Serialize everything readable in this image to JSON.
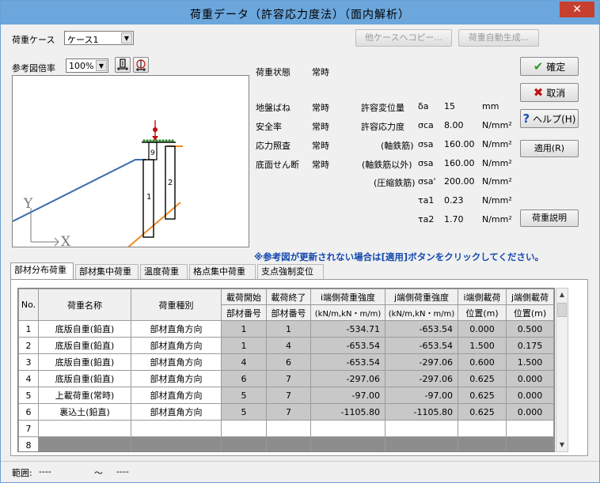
{
  "window": {
    "title": "荷重データ（許容応力度法）（面内解析）",
    "close": "✕"
  },
  "case": {
    "label": "荷重ケース",
    "value": "ケース1"
  },
  "buttons": {
    "copy_other": "他ケースへコピー...",
    "auto_gen": "荷重自動生成...",
    "ok": "確定",
    "cancel": "取消",
    "help": "ヘルプ(H)",
    "apply": "適用(R)",
    "load_desc": "荷重説明"
  },
  "zoom": {
    "label": "参考図倍率",
    "value": "100%"
  },
  "diagram": {
    "y_label": "Y",
    "x_label": "X",
    "member_labels": [
      "1",
      "2",
      "9"
    ]
  },
  "props": {
    "load_state": {
      "label": "荷重状態",
      "value": "常時"
    },
    "left": [
      {
        "label": "地盤ばね",
        "value": "常時"
      },
      {
        "label": "安全率",
        "value": "常時"
      },
      {
        "label": "応力照査",
        "value": "常時"
      },
      {
        "label": "底面せん断",
        "value": "常時"
      }
    ],
    "right": [
      {
        "label": "許容変位量",
        "sym": "δa",
        "value": "15",
        "unit": "mm"
      },
      {
        "label": "許容応力度",
        "sym": "σca",
        "value": "8.00",
        "unit": "N/mm²"
      },
      {
        "label": "(軸鉄筋)",
        "sym": "σsa",
        "value": "160.00",
        "unit": "N/mm²"
      },
      {
        "label": "(軸鉄筋以外)",
        "sym": "σsa",
        "value": "160.00",
        "unit": "N/mm²"
      },
      {
        "label": "(圧縮鉄筋)",
        "sym": "σsa'",
        "value": "200.00",
        "unit": "N/mm²"
      },
      {
        "label": "",
        "sym": "τa1",
        "value": "0.23",
        "unit": "N/mm²"
      },
      {
        "label": "",
        "sym": "τa2",
        "value": "1.70",
        "unit": "N/mm²"
      }
    ]
  },
  "note": "※参考図が更新されない場合は[適用]ボタンをクリックしてください。",
  "tabs": [
    "部材分布荷重",
    "部材集中荷重",
    "温度荷重",
    "格点集中荷重",
    "支点強制変位"
  ],
  "table": {
    "headers_top": [
      "No.",
      "荷重名称",
      "荷重種別",
      "載荷開始",
      "載荷終了",
      "i端側荷重強度",
      "j端側荷重強度",
      "i端側載荷",
      "j端側載荷"
    ],
    "headers_bottom": [
      "部材番号",
      "部材番号",
      "(kN/m,kN・m/m)",
      "(kN/m,kN・m/m)",
      "位置(m)",
      "位置(m)"
    ],
    "rows": [
      [
        "1",
        "底版自重(鉛直)",
        "部材直角方向",
        "1",
        "1",
        "-534.71",
        "-653.54",
        "0.000",
        "0.500"
      ],
      [
        "2",
        "底版自重(鉛直)",
        "部材直角方向",
        "1",
        "4",
        "-653.54",
        "-653.54",
        "1.500",
        "0.175"
      ],
      [
        "3",
        "底版自重(鉛直)",
        "部材直角方向",
        "4",
        "6",
        "-653.54",
        "-297.06",
        "0.600",
        "1.500"
      ],
      [
        "4",
        "底版自重(鉛直)",
        "部材直角方向",
        "6",
        "7",
        "-297.06",
        "-297.06",
        "0.625",
        "0.000"
      ],
      [
        "5",
        "上載荷重(常時)",
        "部材直角方向",
        "5",
        "7",
        "-97.00",
        "-97.00",
        "0.625",
        "0.000"
      ],
      [
        "6",
        "裏込土(鉛直)",
        "部材直角方向",
        "5",
        "7",
        "-1105.80",
        "-1105.80",
        "0.625",
        "0.000"
      ]
    ],
    "empty_rows": [
      "7",
      "8"
    ]
  },
  "status": {
    "range_label": "範囲:",
    "from": "----",
    "tilde": "〜",
    "to": "----"
  }
}
